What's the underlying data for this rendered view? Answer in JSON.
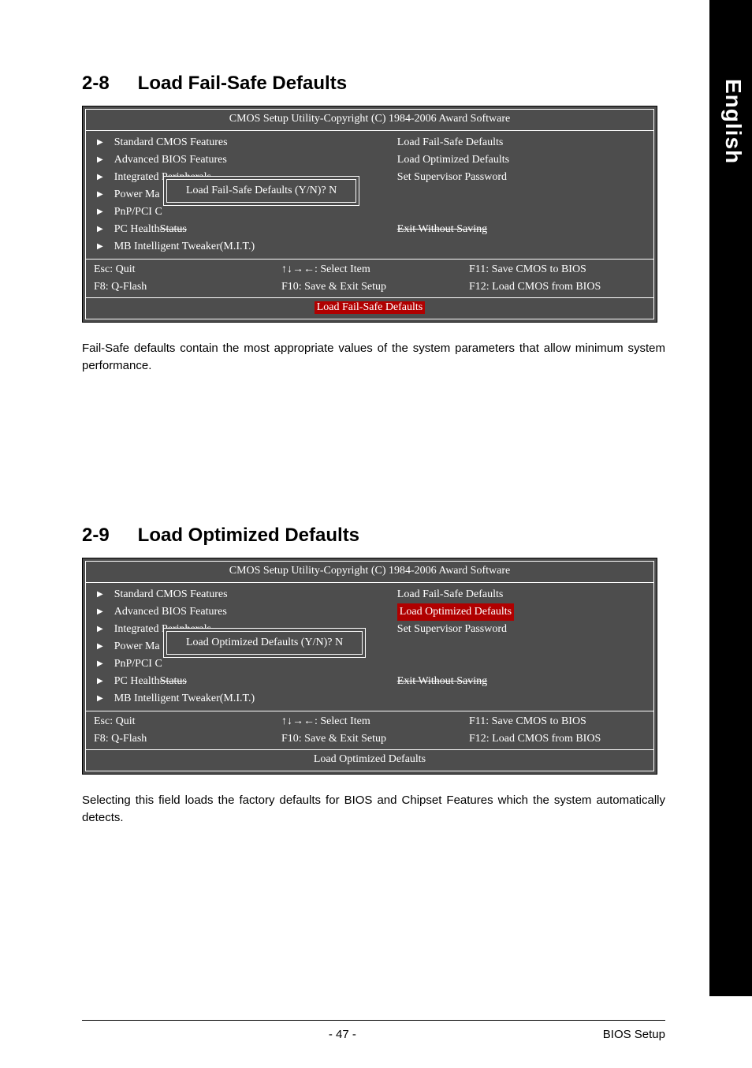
{
  "sideTab": "English",
  "section1": {
    "num": "2-8",
    "title": "Load Fail-Safe Defaults"
  },
  "section2": {
    "num": "2-9",
    "title": "Load Optimized Defaults"
  },
  "bios": {
    "title": "CMOS Setup Utility-Copyright (C) 1984-2006 Award Software",
    "left": {
      "r1": "Standard CMOS Features",
      "r2": "Advanced BIOS Features",
      "r3": "Integrated Peripherals",
      "r4a": "Power Ma",
      "r5a": "PnP/PCI C",
      "r6a": "PC Health ",
      "r6b": "Status",
      "r7": "MB Intelligent Tweaker(M.I.T.)"
    },
    "right": {
      "r1": "Load Fail-Safe Defaults",
      "r2": "Load Optimized Defaults",
      "r3": "Set Supervisor Password",
      "r6b": "Exit Without Saving"
    },
    "hints": {
      "esc": "Esc: Quit",
      "arrows": "↑↓→←: Select Item",
      "f11": "F11: Save CMOS to BIOS",
      "f8": "F8: Q-Flash",
      "f10": "F10: Save & Exit Setup",
      "f12": "F12: Load CMOS from BIOS"
    },
    "footer1": "Load Fail-Safe Defaults",
    "footer2": "Load Optimized Defaults"
  },
  "dialog1": "Load Fail-Safe Defaults (Y/N)? N",
  "dialog2": "Load Optimized Defaults (Y/N)? N",
  "para1": "Fail-Safe defaults contain the most appropriate values of the system parameters that allow minimum system performance.",
  "para2": "Selecting this field loads the factory defaults for BIOS and Chipset Features which the system automatically detects.",
  "footer": {
    "page": "- 47 -",
    "section": "BIOS Setup"
  }
}
